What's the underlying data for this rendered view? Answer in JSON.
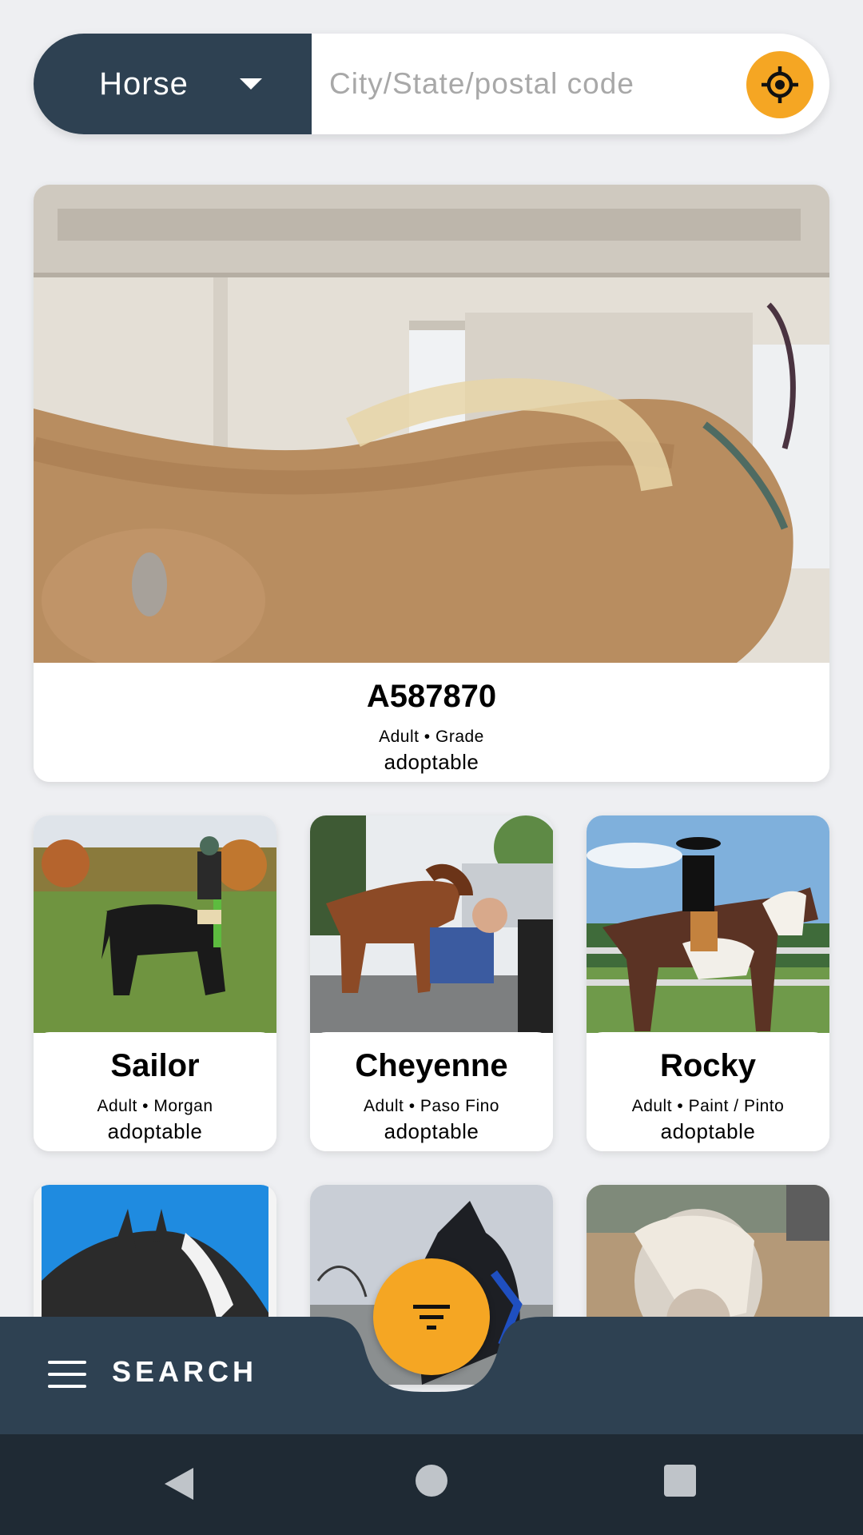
{
  "search": {
    "species": "Horse",
    "location_placeholder": "City/State/postal code",
    "location_value": ""
  },
  "featured": {
    "name": "A587870",
    "meta": "Adult • Grade",
    "status": "adoptable"
  },
  "cards": [
    {
      "name": "Sailor",
      "meta": "Adult • Morgan",
      "status": "adoptable"
    },
    {
      "name": "Cheyenne",
      "meta": "Adult • Paso Fino",
      "status": "adoptable"
    },
    {
      "name": "Rocky",
      "meta": "Adult • Paint / Pinto",
      "status": "adoptable"
    }
  ],
  "bottom_bar": {
    "label": "SEARCH"
  },
  "colors": {
    "primary_dark": "#2e4152",
    "accent": "#f5a623",
    "background": "#eeeff2",
    "system_nav": "#1f2a34"
  },
  "icons": {
    "species_dropdown": "caret-down-icon",
    "locate": "crosshair-icon",
    "menu": "hamburger-menu-icon",
    "filter": "filter-icon"
  }
}
